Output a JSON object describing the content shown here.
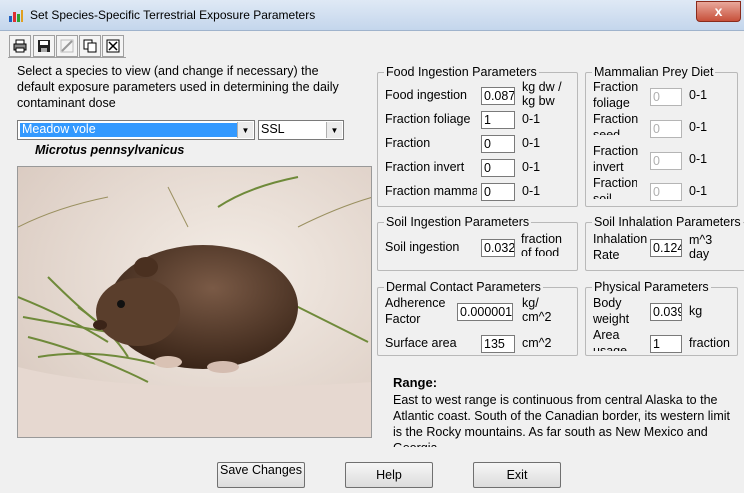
{
  "window": {
    "title": "Set Species-Specific Terrestrial Exposure Parameters",
    "close_label": "x"
  },
  "toolbar": {
    "icons": [
      "print-icon",
      "save-icon",
      "edit-icon",
      "copy-icon",
      "excel-icon"
    ]
  },
  "intro_text": "Select a species to view (and change if necessary) the default exposure parameters used in determining the daily contaminant dose",
  "species": {
    "selected": "Meadow vole",
    "latin_name": "Microtus pennsylvanicus"
  },
  "screening": {
    "selected": "SSL"
  },
  "food_ingestion": {
    "legend": "Food Ingestion Parameters",
    "rows": [
      {
        "label": "Food ingestion",
        "value": "0.087",
        "unit": "kg dw / kg bw"
      },
      {
        "label": "Fraction foliage",
        "value": "1",
        "unit": "0-1"
      },
      {
        "label": "Fraction",
        "value": "0",
        "unit": "0-1"
      },
      {
        "label": "Fraction invert",
        "value": "0",
        "unit": "0-1"
      },
      {
        "label": "Fraction mammal",
        "value": "0",
        "unit": "0-1"
      }
    ]
  },
  "mammalian_prey": {
    "legend": "Mammalian Prey Diet",
    "rows": [
      {
        "label": "Fraction foliage",
        "value": "0",
        "unit": "0-1"
      },
      {
        "label": "Fraction seed",
        "value": "0",
        "unit": "0-1"
      },
      {
        "label": "Fraction invert",
        "value": "0",
        "unit": "0-1"
      },
      {
        "label": "Fraction soil",
        "value": "0",
        "unit": "0-1"
      }
    ]
  },
  "soil_ingestion": {
    "legend": "Soil Ingestion Parameters",
    "label": "Soil ingestion",
    "value": "0.032",
    "unit": "fraction of food"
  },
  "soil_inhalation": {
    "legend": "Soil Inhalation Parameters",
    "label": "Inhalation Rate",
    "value": "0.124",
    "unit": "m^3 day"
  },
  "dermal_contact": {
    "legend": "Dermal Contact Parameters",
    "rows": [
      {
        "label": "Adherence Factor",
        "value": "0.000001",
        "unit": "kg/ cm^2"
      },
      {
        "label": "Surface area",
        "value": "135",
        "unit": "cm^2"
      }
    ]
  },
  "physical": {
    "legend": "Physical Parameters",
    "rows": [
      {
        "label": "Body weight",
        "value": "0.039",
        "unit": "kg"
      },
      {
        "label": "Area usage",
        "value": "1",
        "unit": "fraction"
      }
    ]
  },
  "range": {
    "title": "Range:",
    "text": "East to west range is continuous from central Alaska to the Atlantic coast. South of the Canadian border, its western limit is the Rocky mountains. As far south as New Mexico and Georgia."
  },
  "buttons": {
    "save": "Save Changes",
    "help": "Help",
    "exit": "Exit"
  },
  "colors": {
    "selection": "#3399ff",
    "close": "#c7503a"
  }
}
